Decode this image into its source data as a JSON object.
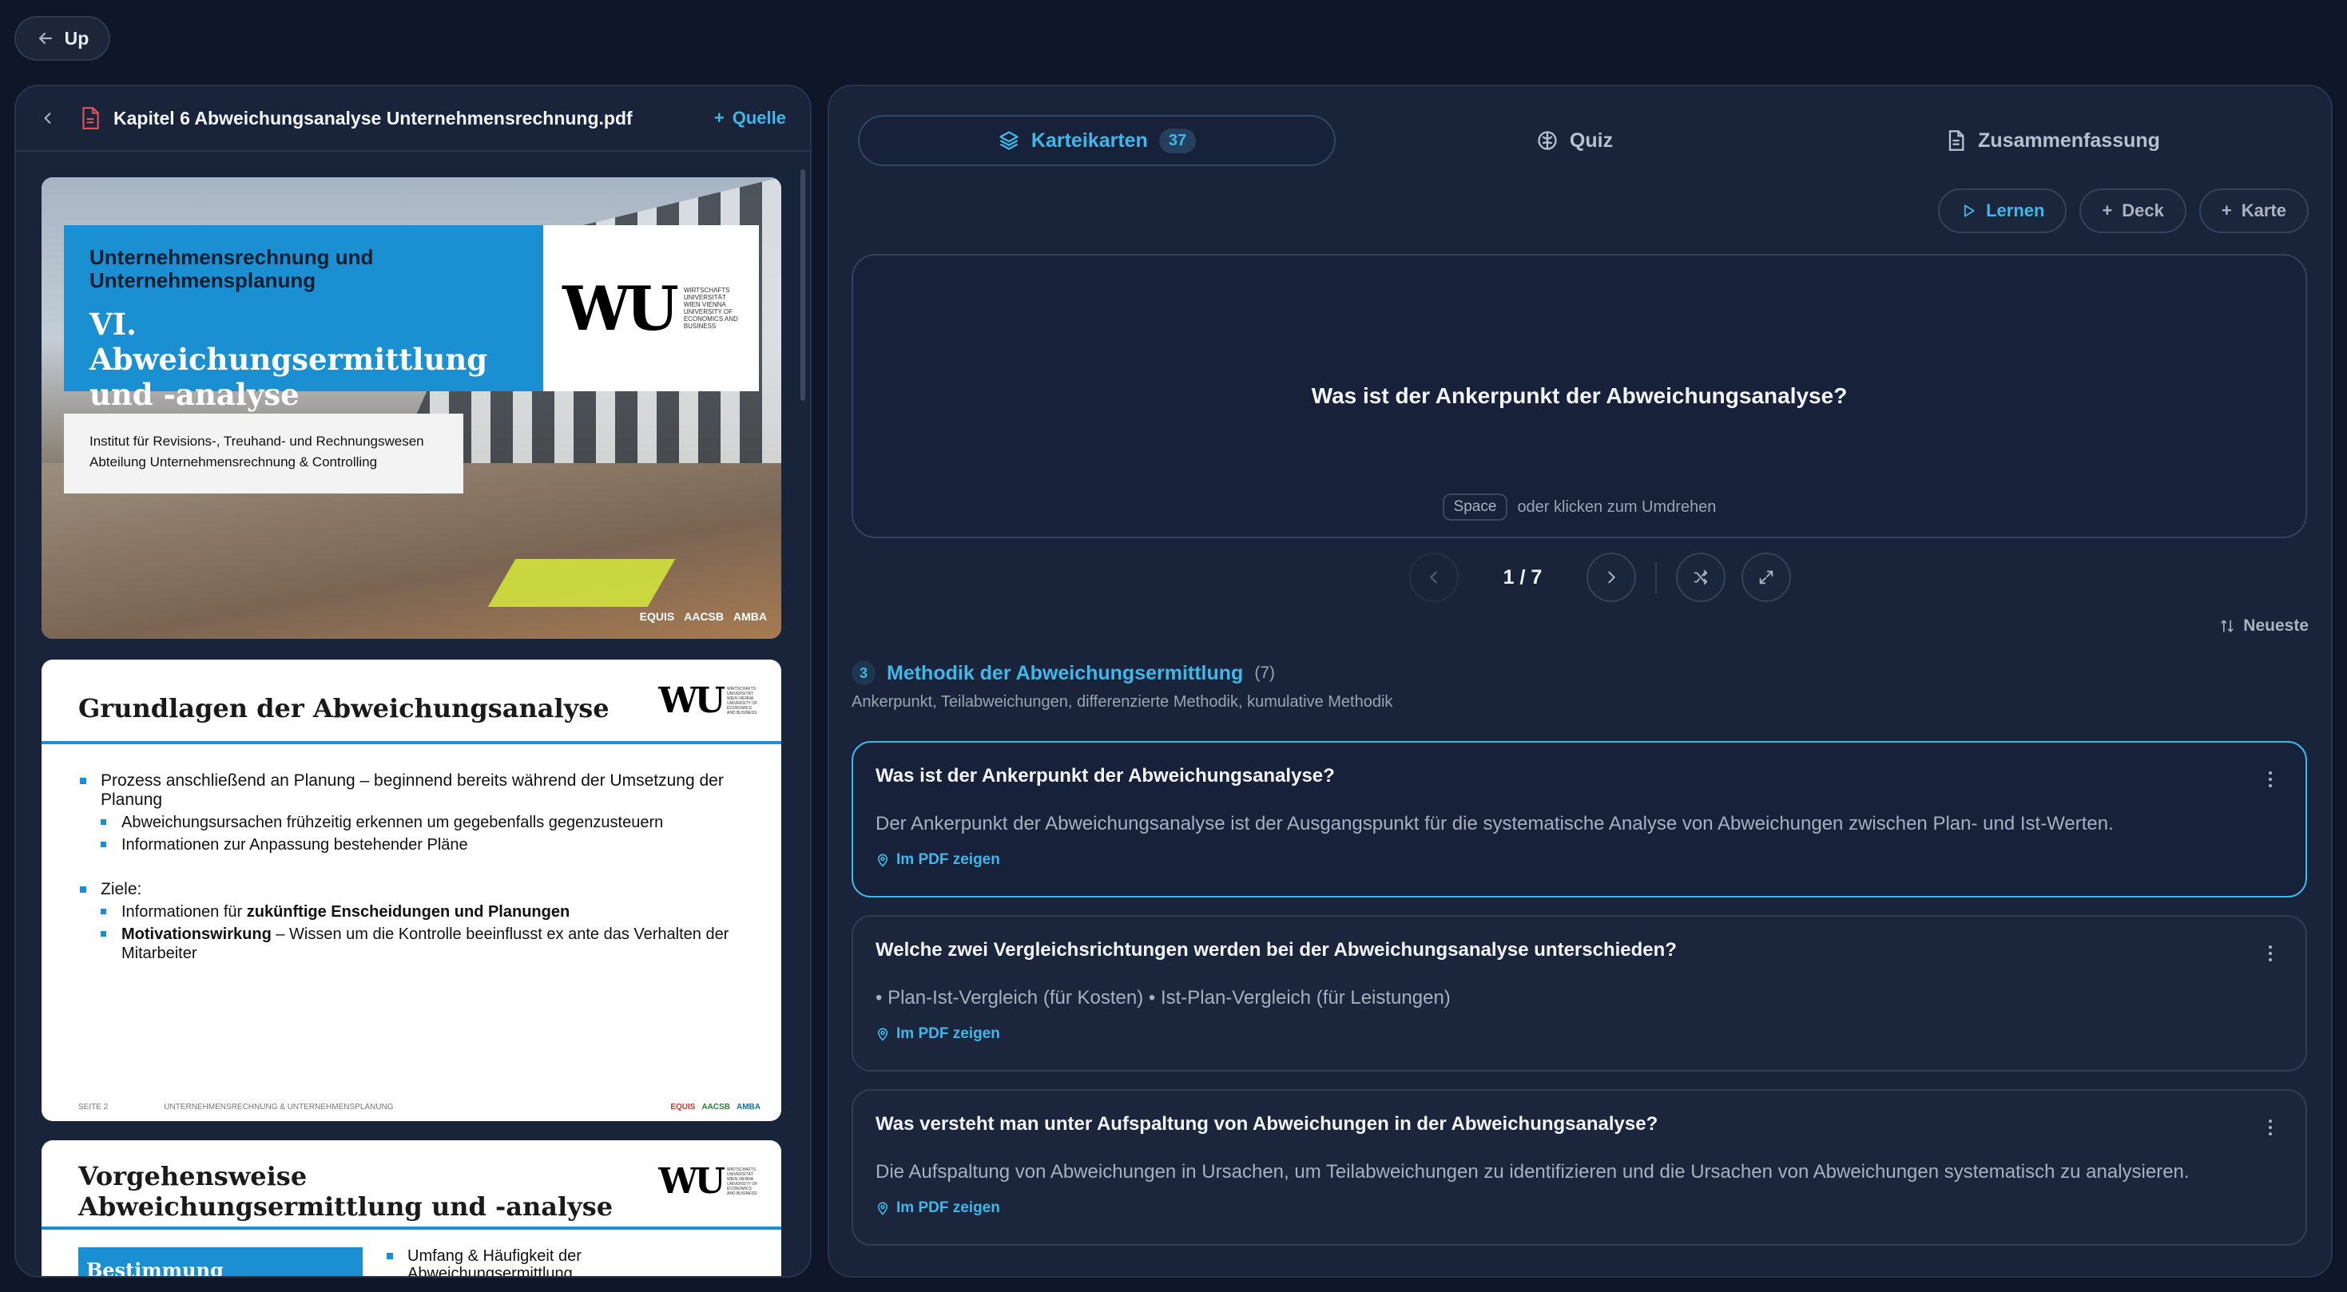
{
  "topbar": {
    "up_label": "Up"
  },
  "pdf_panel": {
    "file_name": "Kapitel 6 Abweichungsanalyse Unternehmensrechnung.pdf",
    "source_label": "Quelle",
    "slide1": {
      "subtitle": "Unternehmensrechnung und Unternehmensplanung",
      "title": "VI. Abweichungsermittlung und -analyse",
      "logo_text": "WU",
      "logo_caption": "WIRTSCHAFTS UNIVERSITÄT WIEN VIENNA UNIVERSITY OF ECONOMICS AND BUSINESS",
      "institute_line1": "Institut für Revisions-, Treuhand- und Rechnungswesen",
      "institute_line2": "Abteilung Unternehmensrechnung & Controlling",
      "badge1": "EQUIS",
      "badge2": "AACSB",
      "badge3": "AMBA"
    },
    "slide2": {
      "title": "Grundlagen der Abweichungsanalyse",
      "b1": "Prozess anschließend an Planung – beginnend bereits während der Umsetzung der Planung",
      "b1_1": "Abweichungsursachen frühzeitig erkennen um gegebenfalls gegenzusteuern",
      "b1_2": "Informationen zur Anpassung bestehender Pläne",
      "b2": "Ziele:",
      "b2_1_pre": "Informationen für ",
      "b2_1_bold": "zukünftige Enscheidungen und Planungen",
      "b2_2_bold": "Motivationswirkung",
      "b2_2_rest": " – Wissen um die Kontrolle beeinflusst ex ante das Verhalten der Mitarbeiter",
      "footer_page": "SEITE 2",
      "footer_course": "UNTERNEHMENSRECHNUNG & UNTERNEHMENSPLANUNG"
    },
    "slide3": {
      "title": "Vorgehensweise Abweichungsermittlung und -analyse",
      "box": "Bestimmung Kontrollfeld",
      "bullet": "Umfang & Häufigkeit der Abweichungsermittlung"
    }
  },
  "tabs": [
    {
      "label": "Karteikarten",
      "count": "37",
      "active": true
    },
    {
      "label": "Quiz",
      "active": false
    },
    {
      "label": "Zusammenfassung",
      "active": false
    }
  ],
  "actions": {
    "learn": "Lernen",
    "deck": "Deck",
    "card": "Karte"
  },
  "flashcard": {
    "question": "Was ist der Ankerpunkt der Abweichungsanalyse?",
    "key_hint": "Space",
    "hint_text": "oder klicken zum Umdrehen",
    "position": "1 / 7"
  },
  "sort_label": "Neueste",
  "section": {
    "number": "3",
    "title": "Methodik der Abweichungsermittlung",
    "count": "(7)",
    "tags": "Ankerpunkt, Teilabweichungen, differenzierte Methodik, kumulative Methodik"
  },
  "cards": [
    {
      "question": "Was ist der Ankerpunkt der Abweichungsanalyse?",
      "answer": "Der Ankerpunkt der Abweichungsanalyse ist der Ausgangspunkt für die systematische Analyse von Abweichungen zwischen Plan- und Ist-Werten.",
      "link": "Im PDF zeigen"
    },
    {
      "question": "Welche zwei Vergleichsrichtungen werden bei der Abweichungsanalyse unterschieden?",
      "answer": "• Plan-Ist-Vergleich (für Kosten) • Ist-Plan-Vergleich (für Leistungen)",
      "link": "Im PDF zeigen"
    },
    {
      "question": "Was versteht man unter Aufspaltung von Abweichungen in der Abweichungsanalyse?",
      "answer": "Die Aufspaltung von Abweichungen in Ursachen, um Teilabweichungen zu identifizieren und die Ursachen von Abweichungen systematisch zu analysieren.",
      "link": "Im PDF zeigen"
    }
  ],
  "colors": {
    "accent": "#3fb7e8",
    "background": "#0e1627",
    "panel": "#19243a",
    "slide_blue": "#1a8fd1"
  }
}
